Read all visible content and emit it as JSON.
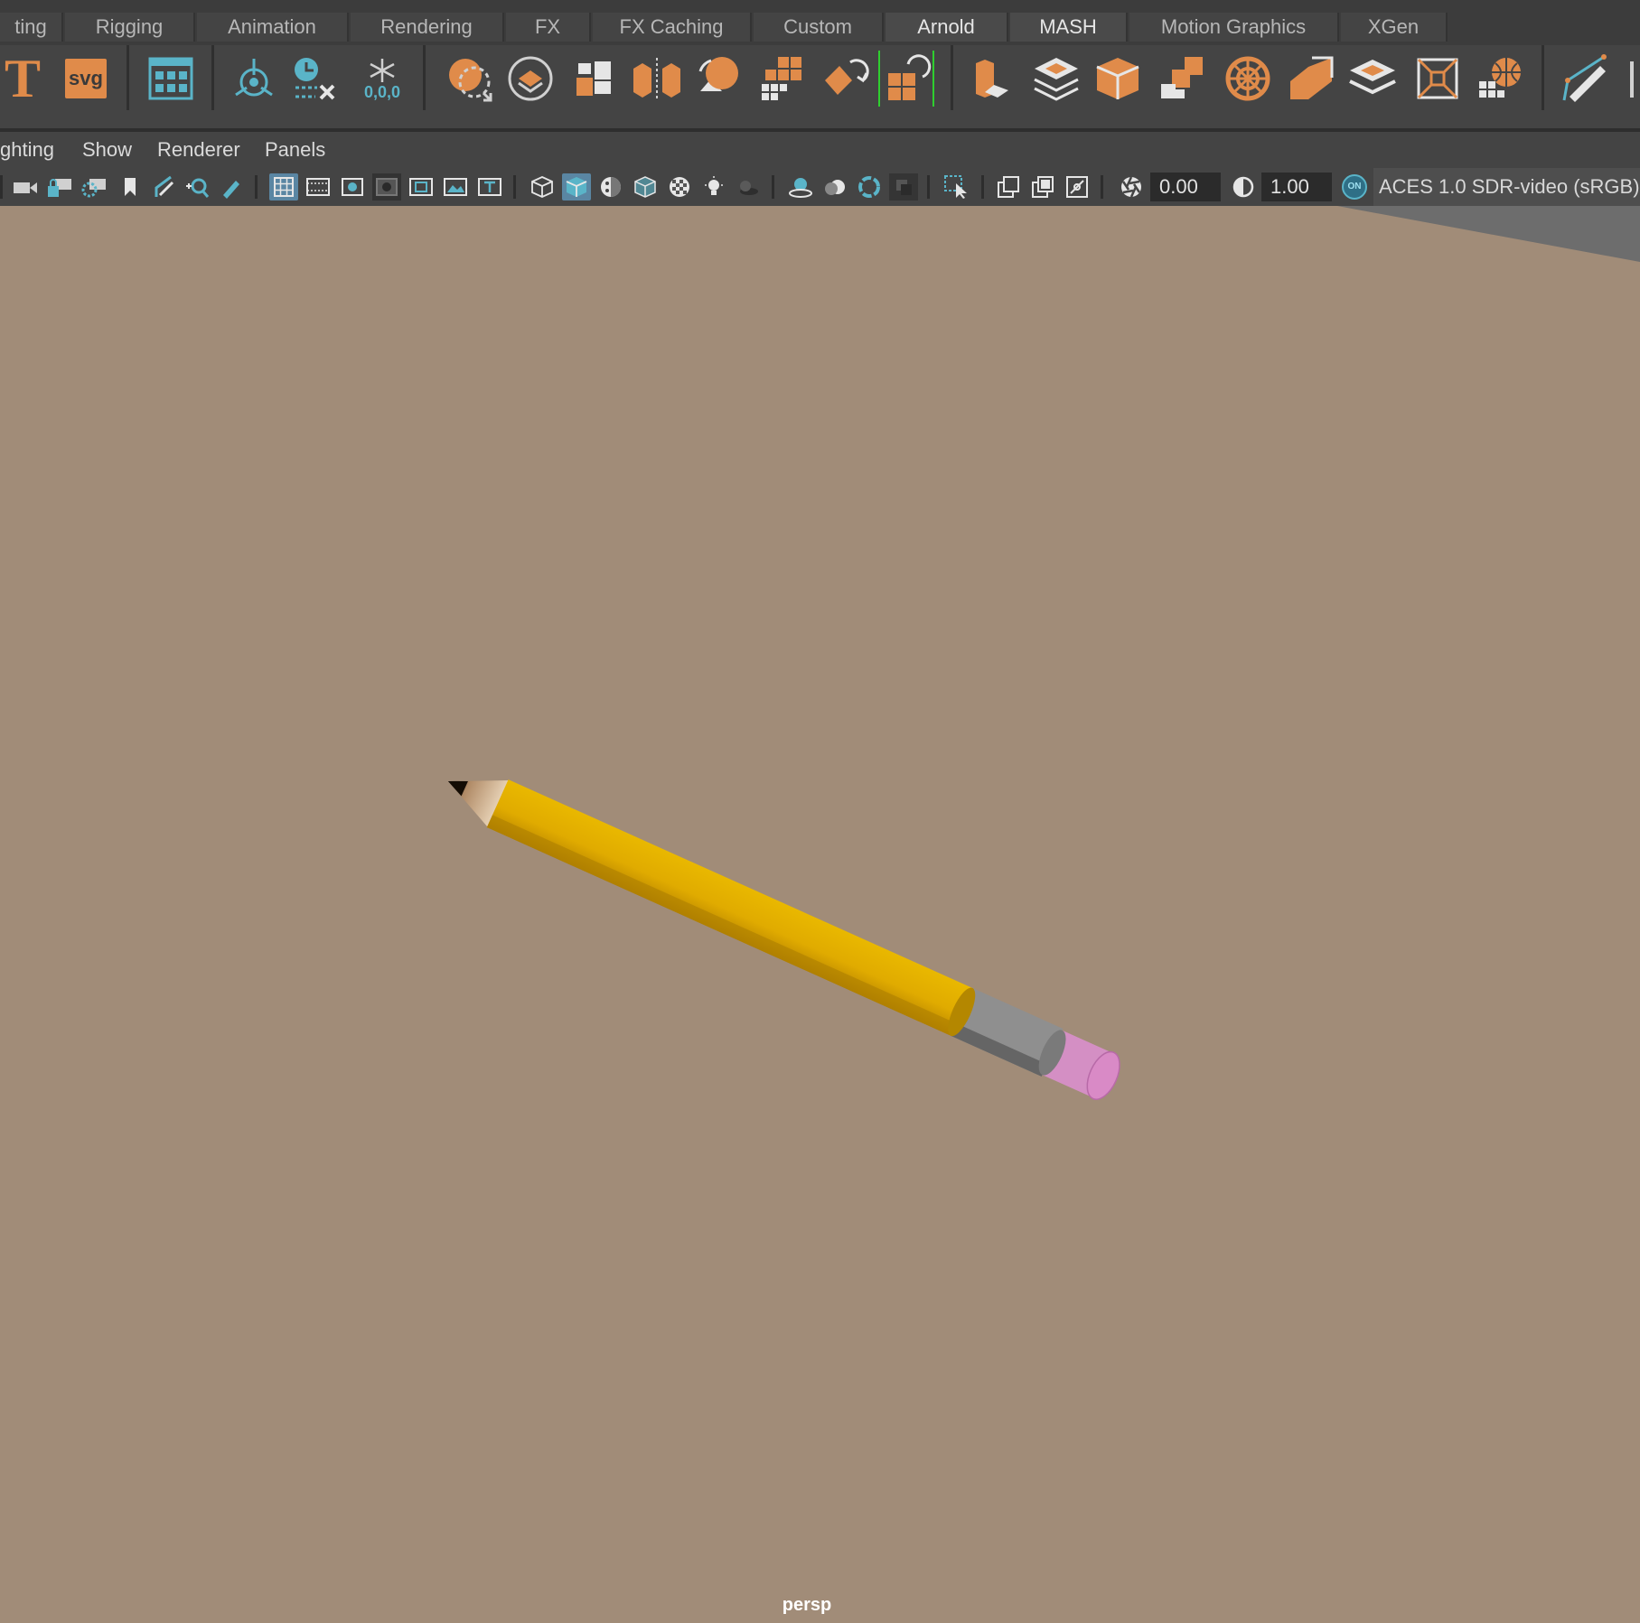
{
  "shelf_tabs": [
    {
      "label": "ting",
      "active": false
    },
    {
      "label": "Rigging",
      "active": false
    },
    {
      "label": "Animation",
      "active": false
    },
    {
      "label": "Rendering",
      "active": false
    },
    {
      "label": "FX",
      "active": false
    },
    {
      "label": "FX Caching",
      "active": false
    },
    {
      "label": "Custom",
      "active": false
    },
    {
      "label": "Arnold",
      "active": true
    },
    {
      "label": "MASH",
      "active": true
    },
    {
      "label": "Motion Graphics",
      "active": false
    },
    {
      "label": "XGen",
      "active": false
    }
  ],
  "shelf_icons": {
    "text_icon_label": "T",
    "svg_icon_label": "svg",
    "freeze_icon_label": "0,0,0"
  },
  "panel_menus": [
    "ghting",
    "Show",
    "Renderer",
    "Panels"
  ],
  "view_toolbar": {
    "exposure_value": "0.00",
    "gamma_value": "1.00",
    "colorspace_toggle_label": "ON",
    "colorspace_label": "ACES 1.0 SDR-video (sRGB)"
  },
  "viewport": {
    "camera_name": "persp",
    "background_color": "#a18c78"
  },
  "colors": {
    "shelf_accent": "#e08b4a",
    "toolbar_accent": "#5ab4c8",
    "pencil_body": "#e4b000",
    "ferrule": "#8d8d8d",
    "eraser": "#d990c8"
  }
}
